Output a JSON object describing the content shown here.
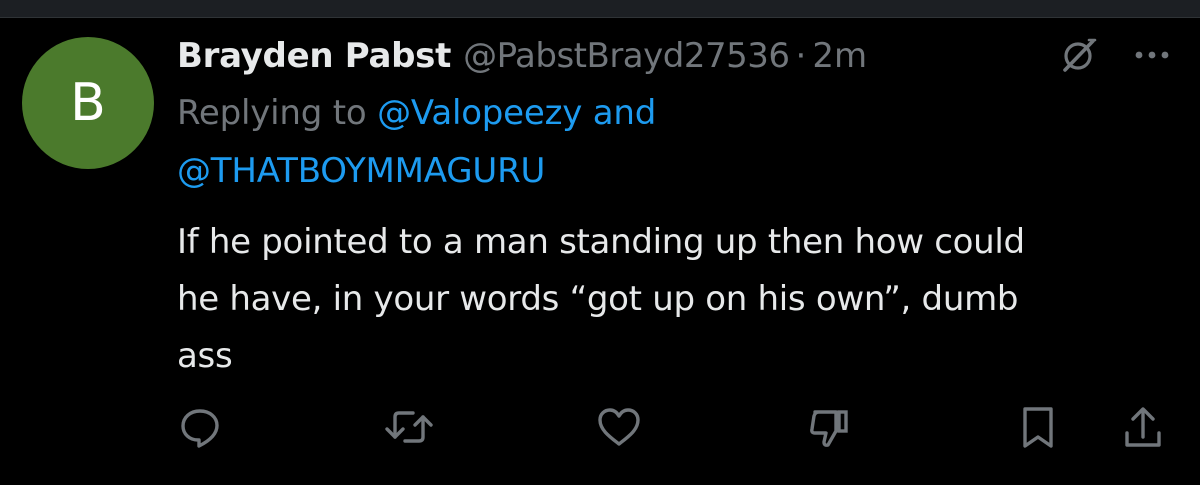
{
  "tweet": {
    "avatar_letter": "B",
    "avatar_color": "#4b7a2c",
    "display_name": "Brayden Pabst",
    "handle": "@PabstBrayd27536",
    "separator": "·",
    "timestamp": "2m",
    "replying_prefix": "Replying to ",
    "reply_mention_1": "@Valopeezy",
    "reply_and": " and",
    "reply_mention_2": "@THATBOYMMAGURU",
    "text_line_1": "If he pointed to a man standing up then how could",
    "text_line_2": "he have, in your words “got up on his own”, dumb",
    "text_line_3": "ass"
  },
  "icons": {
    "top_right": [
      "grok-icon",
      "more-icon"
    ],
    "actions": [
      "reply-icon",
      "retweet-icon",
      "like-icon",
      "downvote-icon",
      "bookmark-icon",
      "share-icon"
    ]
  },
  "colors": {
    "background": "#000000",
    "primary_text": "#e7e9ea",
    "secondary_text": "#71767b",
    "link": "#1d9bf0"
  }
}
